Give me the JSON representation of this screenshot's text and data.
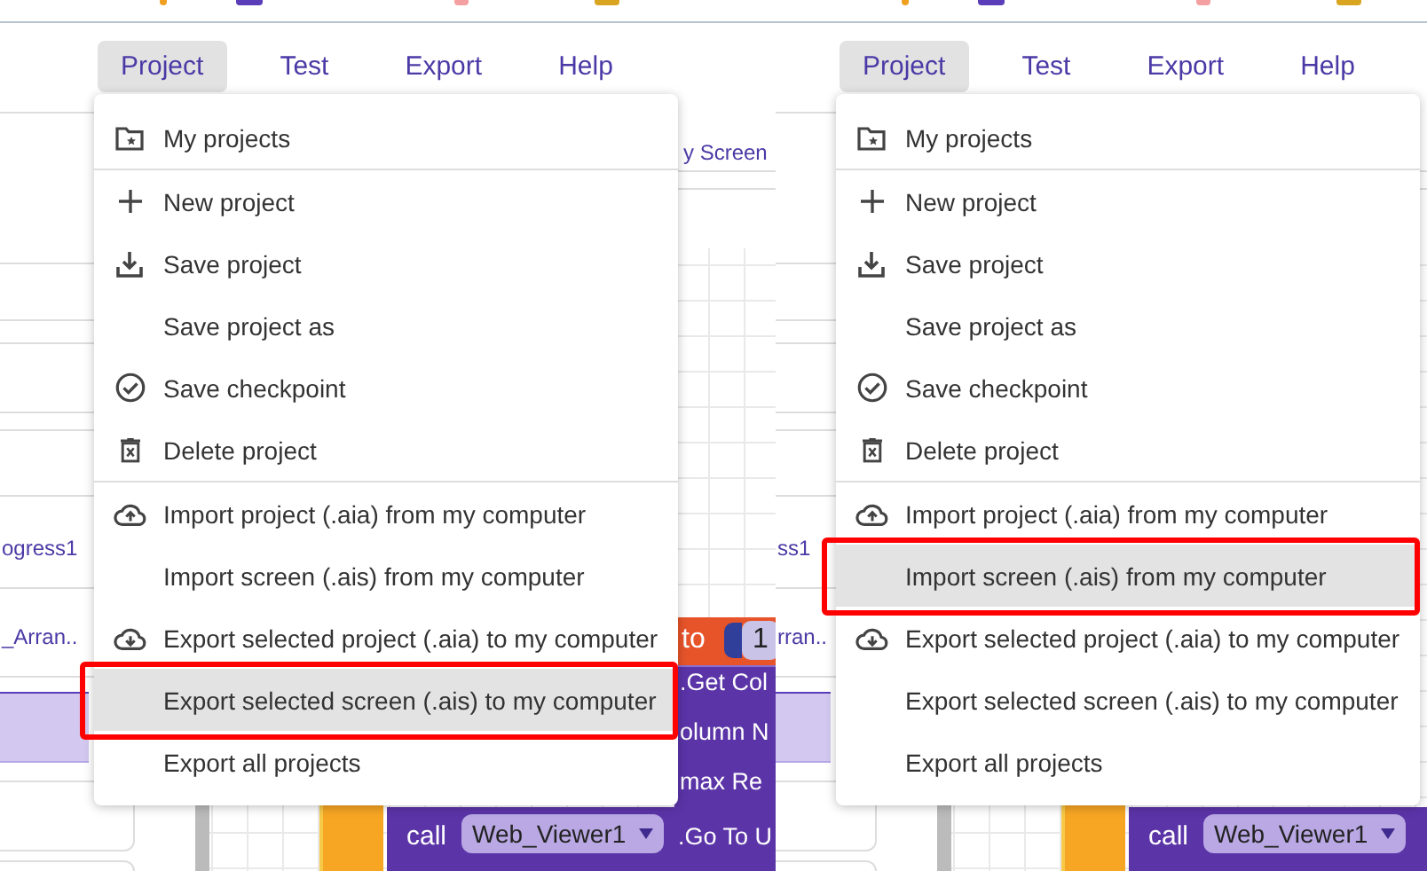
{
  "panels": [
    {
      "menubar": [
        {
          "label": "Project",
          "selected": true
        },
        {
          "label": "Test",
          "selected": false
        },
        {
          "label": "Export",
          "selected": false
        },
        {
          "label": "Help",
          "selected": false
        }
      ],
      "menu": [
        [
          {
            "label": "My projects",
            "selected": false,
            "outlined": false
          }
        ],
        [
          {
            "label": "New project",
            "selected": false,
            "outlined": false
          },
          {
            "label": "Save project",
            "selected": false,
            "outlined": false
          },
          {
            "label": "Save project as",
            "selected": false,
            "outlined": false
          },
          {
            "label": "Save checkpoint",
            "selected": false,
            "outlined": false
          },
          {
            "label": "Delete project",
            "selected": false,
            "outlined": false
          }
        ],
        [
          {
            "label": "Import project (.aia) from my computer",
            "selected": false,
            "outlined": false
          },
          {
            "label": "Import screen (.ais) from my computer",
            "selected": false,
            "outlined": false
          },
          {
            "label": "Export selected project (.aia) to my computer",
            "selected": false,
            "outlined": false
          },
          {
            "label": "Export selected screen (.ais) to my computer",
            "selected": true,
            "outlined": true
          },
          {
            "label": "Export all projects",
            "selected": false,
            "outlined": false
          }
        ]
      ],
      "screen_label": "y Screen",
      "sidebar": [
        "ogress1",
        "_Arran.."
      ],
      "blocks": {
        "set_word": "to",
        "number": "1",
        "lines": [
          ".Get Col",
          "olumn N",
          "max Re"
        ],
        "call": "call",
        "component": "Web_Viewer1",
        "method": ".Go To U"
      }
    },
    {
      "menubar": [
        {
          "label": "Project",
          "selected": true
        },
        {
          "label": "Test",
          "selected": false
        },
        {
          "label": "Export",
          "selected": false
        },
        {
          "label": "Help",
          "selected": false
        }
      ],
      "menu": [
        [
          {
            "label": "My projects",
            "selected": false,
            "outlined": false
          }
        ],
        [
          {
            "label": "New project",
            "selected": false,
            "outlined": false
          },
          {
            "label": "Save project",
            "selected": false,
            "outlined": false
          },
          {
            "label": "Save project as",
            "selected": false,
            "outlined": false
          },
          {
            "label": "Save checkpoint",
            "selected": false,
            "outlined": false
          },
          {
            "label": "Delete project",
            "selected": false,
            "outlined": false
          }
        ],
        [
          {
            "label": "Import project (.aia) from my computer",
            "selected": false,
            "outlined": false
          },
          {
            "label": "Import screen (.ais) from my computer",
            "selected": true,
            "outlined": true
          },
          {
            "label": "Export selected project (.aia) to my computer",
            "selected": false,
            "outlined": false
          },
          {
            "label": "Export selected screen (.ais) to my computer",
            "selected": false,
            "outlined": false
          },
          {
            "label": "Export all projects",
            "selected": false,
            "outlined": false
          }
        ]
      ],
      "sidebar": [
        "ss1",
        "rran.."
      ],
      "blocks": {
        "call": "call",
        "component": "Web_Viewer1"
      }
    }
  ]
}
